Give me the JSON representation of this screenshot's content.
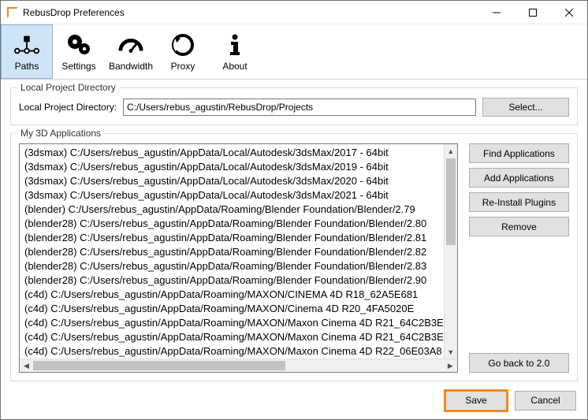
{
  "window": {
    "title": "RebusDrop Preferences"
  },
  "tabs": [
    {
      "label": "Paths",
      "selected": true
    },
    {
      "label": "Settings"
    },
    {
      "label": "Bandwidth"
    },
    {
      "label": "Proxy"
    },
    {
      "label": "About"
    }
  ],
  "projectDir": {
    "legend": "Local Project Directory",
    "label": "Local Project Directory:",
    "value": "C:/Users/rebus_agustin/RebusDrop/Projects",
    "selectBtn": "Select..."
  },
  "apps": {
    "legend": "My 3D Applications",
    "items": [
      "(3dsmax) C:/Users/rebus_agustin/AppData/Local/Autodesk/3dsMax/2017 - 64bit",
      "(3dsmax) C:/Users/rebus_agustin/AppData/Local/Autodesk/3dsMax/2019 - 64bit",
      "(3dsmax) C:/Users/rebus_agustin/AppData/Local/Autodesk/3dsMax/2020 - 64bit",
      "(3dsmax) C:/Users/rebus_agustin/AppData/Local/Autodesk/3dsMax/2021 - 64bit",
      "(blender) C:/Users/rebus_agustin/AppData/Roaming/Blender Foundation/Blender/2.79",
      "(blender28) C:/Users/rebus_agustin/AppData/Roaming/Blender Foundation/Blender/2.80",
      "(blender28) C:/Users/rebus_agustin/AppData/Roaming/Blender Foundation/Blender/2.81",
      "(blender28) C:/Users/rebus_agustin/AppData/Roaming/Blender Foundation/Blender/2.82",
      "(blender28) C:/Users/rebus_agustin/AppData/Roaming/Blender Foundation/Blender/2.83",
      "(blender28) C:/Users/rebus_agustin/AppData/Roaming/Blender Foundation/Blender/2.90",
      "(c4d) C:/Users/rebus_agustin/AppData/Roaming/MAXON/CINEMA 4D R18_62A5E681",
      "(c4d) C:/Users/rebus_agustin/AppData/Roaming/MAXON/Cinema 4D R20_4FA5020E",
      "(c4d) C:/Users/rebus_agustin/AppData/Roaming/MAXON/Maxon Cinema 4D R21_64C2B3E",
      "(c4d) C:/Users/rebus_agustin/AppData/Roaming/MAXON/Maxon Cinema 4D R21_64C2B3E",
      "(c4d) C:/Users/rebus_agustin/AppData/Roaming/MAXON/Maxon Cinema 4D R22_06E03A8"
    ],
    "buttons": {
      "find": "Find Applications",
      "add": "Add Applications",
      "reinstall": "Re-Install Plugins",
      "remove": "Remove",
      "goback": "Go back to 2.0"
    }
  },
  "footer": {
    "save": "Save",
    "cancel": "Cancel"
  }
}
